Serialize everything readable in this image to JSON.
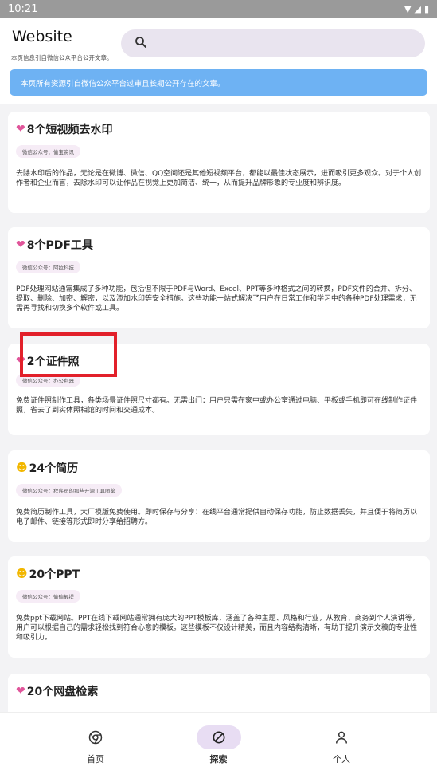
{
  "statusbar": {
    "time": "10:21"
  },
  "header": {
    "title": "Website",
    "subtitle": "本页信息引自微信公众平台公开文章。",
    "search_placeholder": "",
    "notice": "本页所有资源引自微信公众平台过审且长期公开存在的文章。"
  },
  "cards": [
    {
      "icon": "heart",
      "title": "8个短视频去水印",
      "tag": "微信公众号：偷宝资讯",
      "desc": "去除水印后的作品，无论是在微博、微信、QQ空间还是其他短视频平台，都能以最佳状态展示，进而吸引更多观众。对于个人创作者和企业而言，去除水印可以让作品在视觉上更加简洁、统一，从而提升品牌形象的专业度和辨识度。"
    },
    {
      "icon": "heart",
      "title": "8个PDF工具",
      "tag": "微信公众号：阿拉科技",
      "desc": "PDF处理网站通常集成了多种功能，包括但不限于PDF与Word、Excel、PPT等多种格式之间的转换，PDF文件的合并、拆分、提取、删除、加密、解密，以及添加水印等安全措施。这些功能一站式解决了用户在日常工作和学习中的各种PDF处理需求，无需再寻找和切换多个软件或工具。"
    },
    {
      "icon": "heart",
      "title": "2个证件照",
      "tag": "微信公众号：办公利器",
      "desc": "免费证件照制作工具，各类场景证件照尺寸都有。无需出门：用户只需在家中或办公室通过电脑、平板或手机即可在线制作证件照，省去了到实体照相馆的时间和交通成本。"
    },
    {
      "icon": "smile",
      "title": "24个简历",
      "tag": "微信公众号：程序员的那些开源工具图鉴",
      "desc": "免费简历制作工具，大厂模版免费使用。即时保存与分享：在线平台通常提供自动保存功能，防止数据丢失，并且便于将简历以电子邮件、链接等形式即时分享给招聘方。"
    },
    {
      "icon": "smile",
      "title": "20个PPT",
      "tag": "微信公众号：偷偷靓提",
      "desc": "免费ppt下载网站。PPT在线下载网站通常拥有庞大的PPT模板库，涵盖了各种主题、风格和行业，从教育、商务到个人演讲等，用户可以根据自己的需求轻松找到符合心意的模板。这些模板不仅设计精美，而且内容结构清晰，有助于提升演示文稿的专业性和吸引力。"
    },
    {
      "icon": "heart",
      "title": "20个网盘检索",
      "tag": "",
      "desc": ""
    }
  ],
  "bottomnav": {
    "items": [
      {
        "label": "首页",
        "icon": "chrome-icon"
      },
      {
        "label": "探索",
        "icon": "compass-icon"
      },
      {
        "label": "个人",
        "icon": "person-icon"
      }
    ]
  },
  "colors": {
    "notice_bg": "#6eb2f3",
    "highlight": "#e2202a",
    "nav_active": "#e8ddf3",
    "heart": "#e0559a",
    "smile": "#f2b700"
  }
}
